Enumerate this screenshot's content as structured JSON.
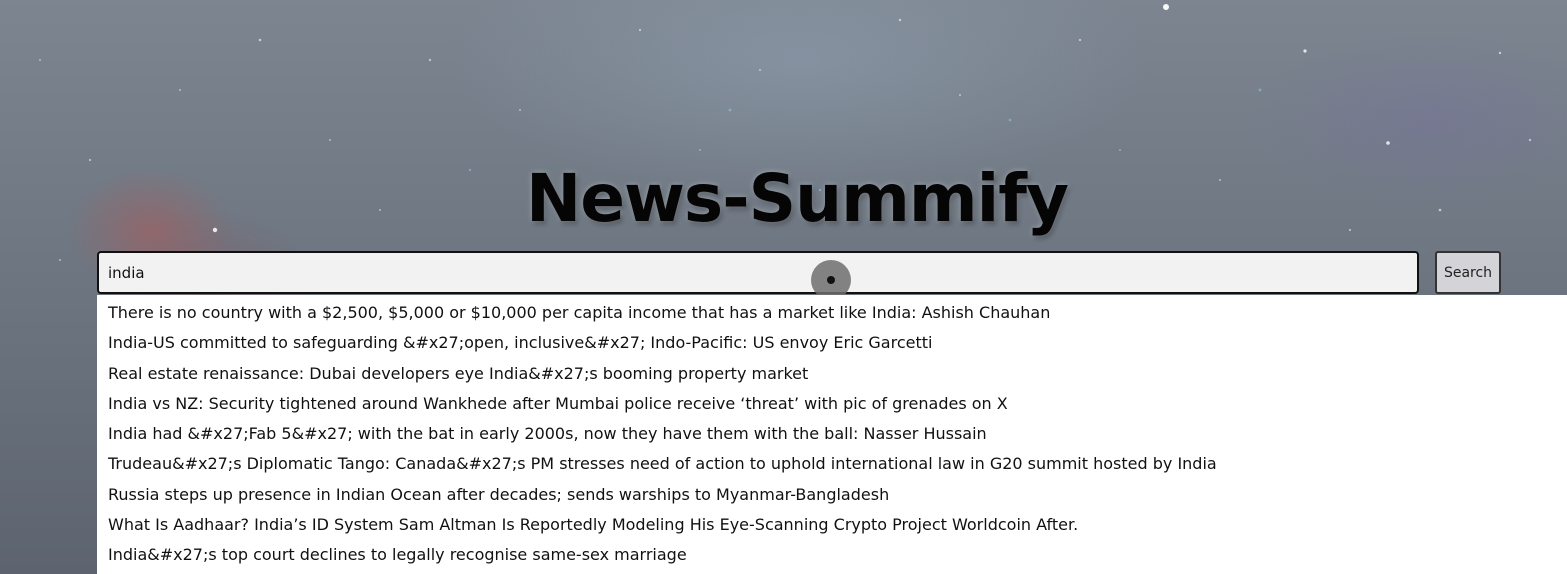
{
  "app": {
    "title": "News-Summify"
  },
  "search": {
    "value": "india",
    "button_label": "Search"
  },
  "suggestions": [
    "There is no country with a $2,500, $5,000 or $10,000 per capita income that has a market like India: Ashish Chauhan",
    "India-US committed to safeguarding &#x27;open, inclusive&#x27; Indo-Pacific: US envoy Eric Garcetti",
    "Real estate renaissance: Dubai developers eye India&#x27;s booming property market",
    "India vs NZ: Security tightened around Wankhede after Mumbai police receive ‘threat’ with pic of grenades on X",
    "India had &#x27;Fab 5&#x27; with the bat in early 2000s, now they have them with the ball: Nasser Hussain",
    "Trudeau&#x27;s Diplomatic Tango: Canada&#x27;s PM stresses need of action to uphold international law in G20 summit hosted by India",
    "Russia steps up presence in Indian Ocean after decades; sends warships to Myanmar-Bangladesh",
    "What Is Aadhaar? India’s ID System Sam Altman Is Reportedly Modeling His Eye-Scanning Crypto Project Worldcoin After.",
    "India&#x27;s top court declines to legally recognise same-sex marriage"
  ],
  "colors": {
    "background": "#6f7883",
    "title": "#050505",
    "input_background": "#f2f2f2",
    "button_background": "#d4d4d8",
    "dropdown_background": "#ffffff"
  },
  "icons": {
    "cursor": "mouse-cursor-indicator"
  }
}
